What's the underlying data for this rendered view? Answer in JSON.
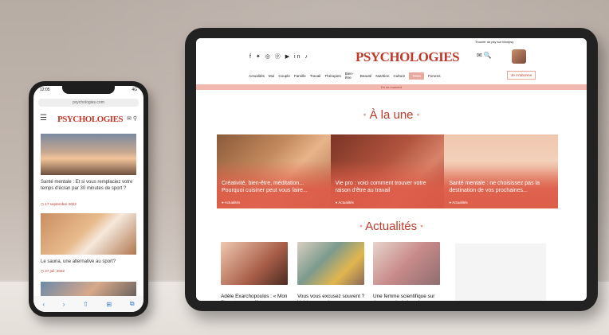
{
  "tablet": {
    "social_icons": "f ✦ ◎ ⓟ ▶ in ♪",
    "logo": "PSYCHOLOGIES",
    "promo": "Trouver un psy sur Monpsy",
    "header_icons": "✉ 🔍",
    "nav": [
      "Actualités",
      "Moi",
      "Couple",
      "Famille",
      "Travail",
      "Thérapies",
      "Bien-être",
      "Beauté",
      "Nutrition",
      "Culture",
      "Tests",
      "Forums"
    ],
    "subscribe": "Je m'abonne",
    "strip": "En ce moment",
    "section1": "À la une",
    "cards": [
      {
        "title": "Créativité, bien-être, méditation... Pourquoi cuisiner peut vous faire...",
        "tag": "Actualités"
      },
      {
        "title": "Vie pro : voici comment trouver votre raison d'être au travail",
        "tag": "Actualités"
      },
      {
        "title": "Santé mentale : ne choisissez pas la destination de vos prochaines...",
        "tag": "Actualités"
      }
    ],
    "section2": "Actualités",
    "news": [
      {
        "caption": "Adèle Exarchopoulos : « Mon fils est mon meilleur"
      },
      {
        "caption": "Vous vous excusez souvent ? Voici pourquoi ça"
      },
      {
        "caption": "Une femme scientifique sur deux serait victime de"
      }
    ]
  },
  "phone": {
    "time": "12:05",
    "signal": "4G",
    "url": "psychologies.com",
    "logo": "PSYCHOLOGIES",
    "article1": "Santé mentale : Et si vous remplaciez votre temps d'écran par 30 minutes de sport ?",
    "date1": "17 septembre 2022",
    "article2": "Le sauna, une alternative au sport?",
    "date2": "27 juil. 2022",
    "bottom_bar": [
      "‹",
      "›",
      "⇧",
      "⊞",
      "⧉"
    ]
  }
}
